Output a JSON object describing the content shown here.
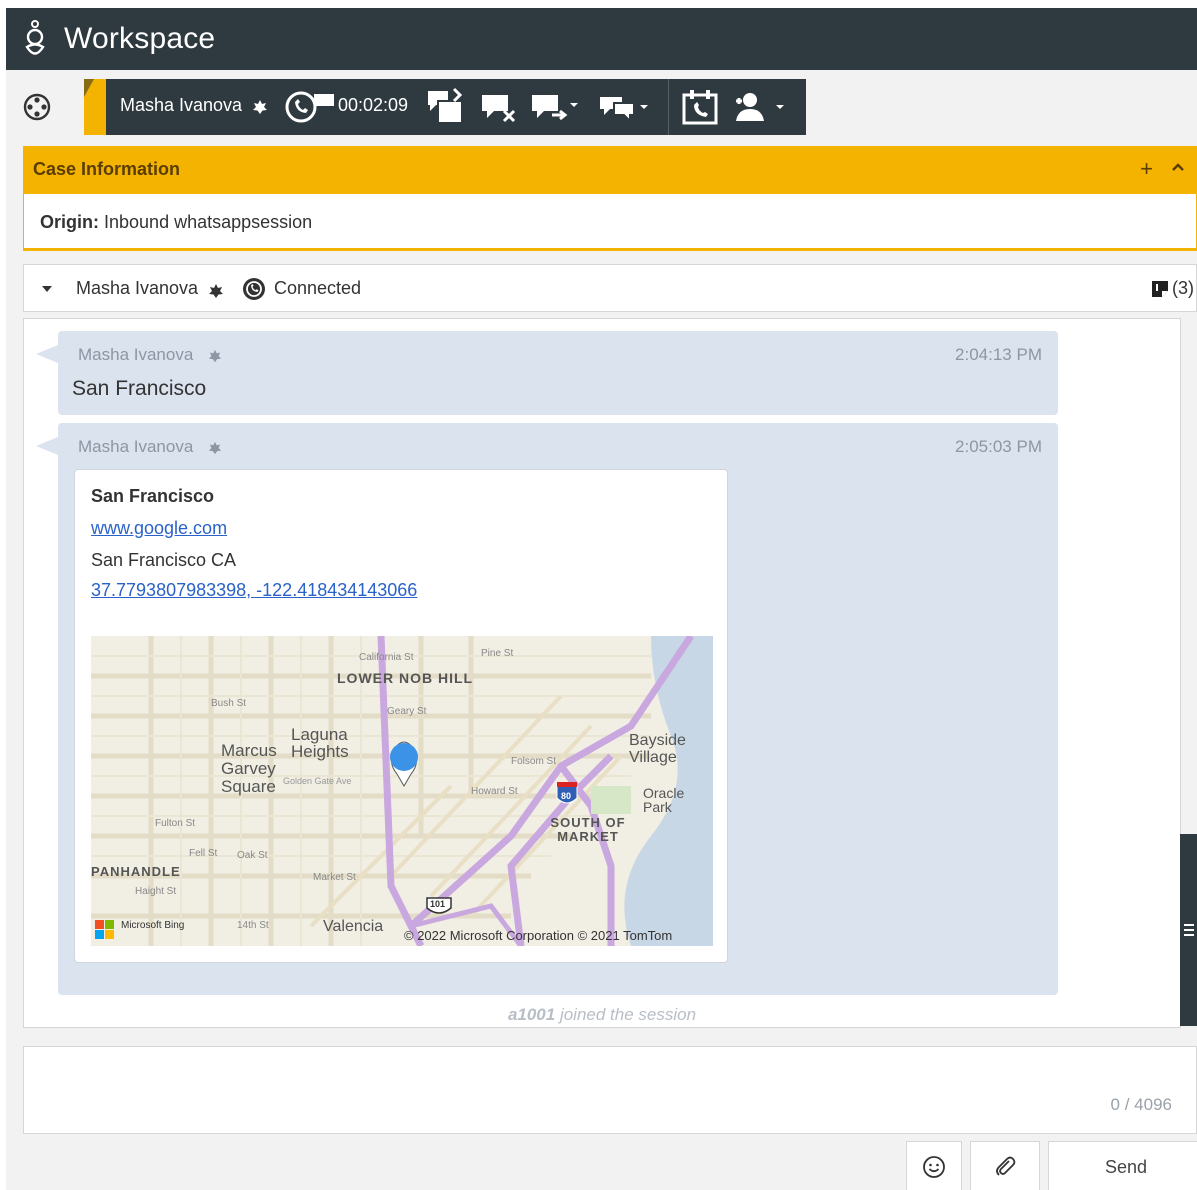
{
  "app": {
    "title": "Workspace"
  },
  "interaction_bar": {
    "contact_name": "Masha Ivanova",
    "timer": "00:02:09",
    "icons": [
      "vip-icon",
      "whatsapp-icon",
      "transfer-icon",
      "end-chat-icon",
      "consult-icon",
      "chat-menu-icon",
      "schedule-callback-icon",
      "contact-menu-icon"
    ]
  },
  "case": {
    "title": "Case Information",
    "add_label": "+",
    "origin_label": "Origin:",
    "origin_value": "Inbound whatsappsession"
  },
  "party": {
    "name": "Masha Ivanova",
    "status": "Connected",
    "notes_count": "(3)"
  },
  "messages": [
    {
      "author": "Masha Ivanova",
      "time": "2:04:13 PM",
      "text": "San Francisco"
    },
    {
      "author": "Masha Ivanova",
      "time": "2:05:03 PM",
      "location": {
        "title": "San Francisco",
        "link": "www.google.com",
        "address": "San Francisco CA",
        "coordinates": "37.7793807983398, -122.418434143066",
        "map_credit": "© 2022 Microsoft Corporation © 2021 TomTom",
        "map_brand": "Microsoft Bing",
        "map_labels": [
          "LOWER NOB HILL",
          "Laguna Heights",
          "Marcus Garvey Square",
          "Bayside Village",
          "Oracle Park",
          "SOUTH OF MARKET",
          "PANHANDLE",
          "Valencia",
          "Bush St",
          "Geary St",
          "California St",
          "Pine St",
          "Fulton St",
          "Oak St",
          "Fell St",
          "Haight St",
          "14th St",
          "Golden Gate Ave",
          "Howard St",
          "Folsom St",
          "Market St",
          "80",
          "101"
        ]
      }
    }
  ],
  "system": {
    "agent": "a1001",
    "text": "joined the session"
  },
  "composer": {
    "counter": "0 / 4096",
    "send_label": "Send"
  },
  "colors": {
    "accent": "#f5b301",
    "dark": "#2f3940",
    "bubble": "#dbe3ef",
    "link": "#2a62c9"
  }
}
